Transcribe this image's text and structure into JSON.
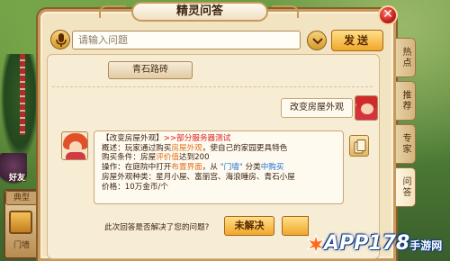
{
  "window": {
    "title": "精灵问答",
    "close_glyph": "✕"
  },
  "background": {
    "friend_label": "好友",
    "hud_tab_label": "典型",
    "hud_door_label": "门墙"
  },
  "input": {
    "placeholder": "请输入问题",
    "value": "",
    "send_label": "发送"
  },
  "chat": {
    "history_chip": "青石路砖",
    "user_question": "改变房屋外观",
    "answer": {
      "title_prefix": "【改变房屋外观】",
      "title_suffix": ">>部分服务器测试",
      "overview_label": "概述：",
      "overview_a": "玩家通过购买",
      "overview_hl": "房屋外观",
      "overview_b": "，使自己的家园更具特色",
      "condition_label": "购买条件：",
      "condition_a": "房屋",
      "condition_hl": "评价值",
      "condition_b": "达到200",
      "operation_label": "操作：",
      "operation_a": "在庭院中打开",
      "operation_hl1": "布置界面",
      "operation_b": "，从 ",
      "operation_hl2": "\"门墙\"",
      "operation_c": " 分类",
      "operation_hl3": "中购买",
      "styles_label": "房屋外观种类：",
      "styles_value": "星月小屋、富丽宫、海浪睡房、青石小屋",
      "price_label": "价格：",
      "price_value": "10万金币/个"
    },
    "feedback_question": "此次回答是否解决了您的问题?",
    "unsolved_label": "未解决"
  },
  "side_tabs": [
    {
      "label": "热点",
      "active": false
    },
    {
      "label": "推荐",
      "active": false
    },
    {
      "label": "专家",
      "active": false
    },
    {
      "label": "问答",
      "active": true
    }
  ],
  "watermark": {
    "text": "APP178",
    "suffix": "手游网"
  },
  "colors": {
    "panel_bg": "#f2e3c1",
    "border_gold": "#c79a5c",
    "button_orange": "#f0a72a",
    "highlight_red": "#d42222",
    "highlight_orange": "#e0701c",
    "highlight_blue": "#1b6fd6",
    "close_red": "#c61e1e"
  },
  "icons": [
    "microphone-icon",
    "chevron-down-icon",
    "close-icon",
    "copy-icon",
    "user-avatar",
    "npc-avatar"
  ]
}
